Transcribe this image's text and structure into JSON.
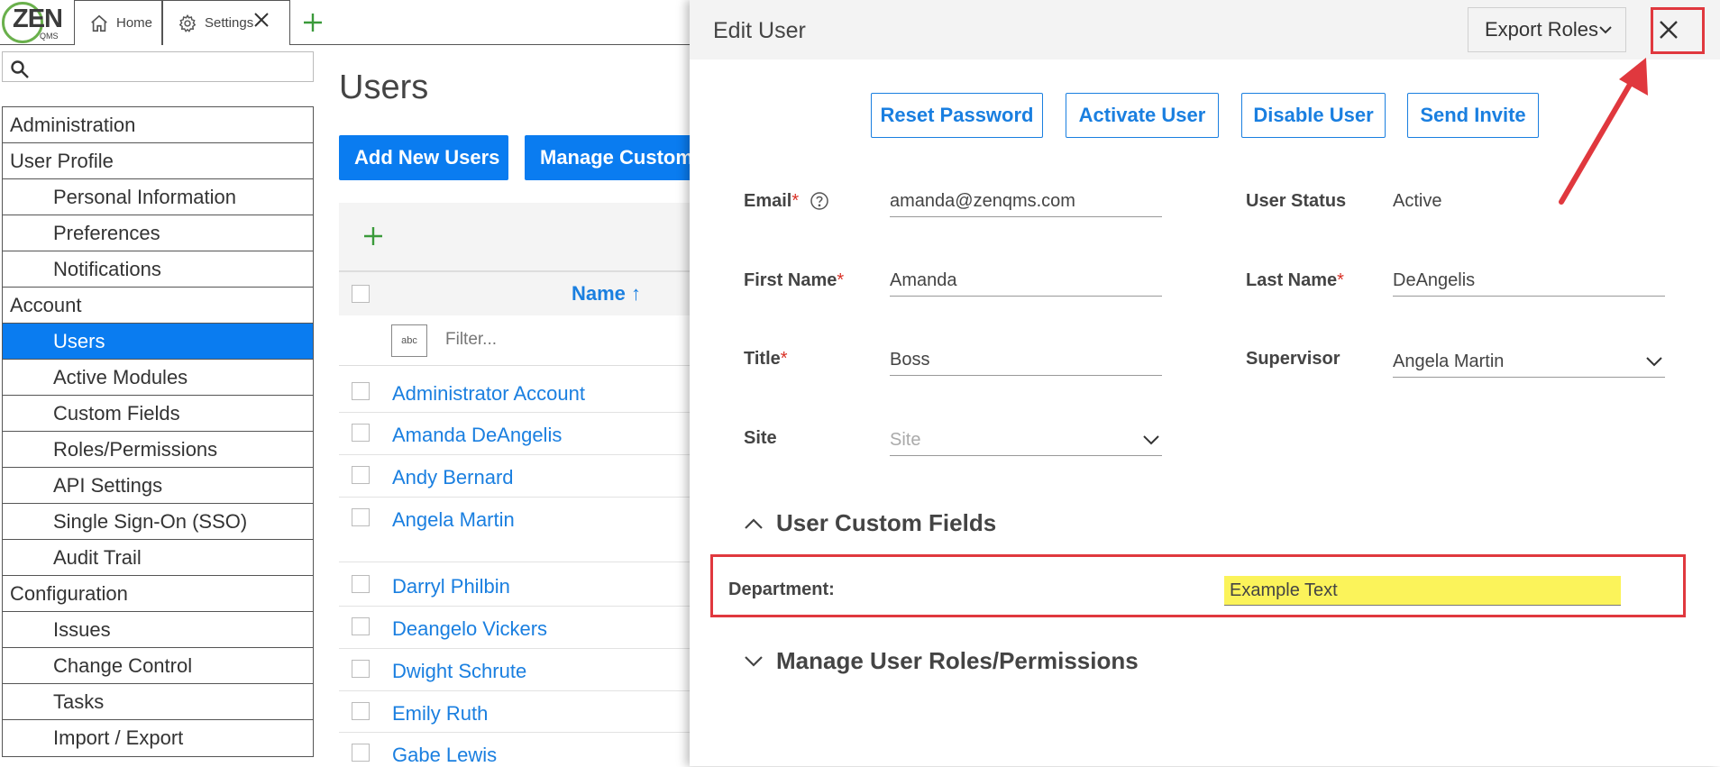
{
  "logo": {
    "text": "ZEN",
    "sub": "QMS"
  },
  "tabs": [
    {
      "label": "Home",
      "icon": "home-icon"
    },
    {
      "label": "Settings",
      "icon": "gear-icon"
    }
  ],
  "search": {
    "placeholder": ""
  },
  "sidebar": {
    "items": [
      {
        "label": "Administration",
        "level": 0
      },
      {
        "label": "User Profile",
        "level": 0
      },
      {
        "label": "Personal Information",
        "level": 1
      },
      {
        "label": "Preferences",
        "level": 1
      },
      {
        "label": "Notifications",
        "level": 1
      },
      {
        "label": "Account",
        "level": 0
      },
      {
        "label": "Users",
        "level": 1,
        "active": true
      },
      {
        "label": "Active Modules",
        "level": 1
      },
      {
        "label": "Custom Fields",
        "level": 1
      },
      {
        "label": "Roles/Permissions",
        "level": 1
      },
      {
        "label": "API Settings",
        "level": 1
      },
      {
        "label": "Single Sign-On (SSO)",
        "level": 1
      },
      {
        "label": "Audit Trail",
        "level": 1
      },
      {
        "label": "Configuration",
        "level": 0
      },
      {
        "label": "Issues",
        "level": 1
      },
      {
        "label": "Change Control",
        "level": 1
      },
      {
        "label": "Tasks",
        "level": 1
      },
      {
        "label": "Import / Export",
        "level": 1
      }
    ]
  },
  "users_page": {
    "title": "Users",
    "add_button": "Add New Users",
    "manage_button": "Manage Custom",
    "column_name": "Name ↑",
    "filter_icon": "abc",
    "filter_placeholder": "Filter...",
    "rows": [
      "Administrator Account",
      "Amanda DeAngelis",
      "Andy Bernard",
      "Angela Martin",
      "Darryl Philbin",
      "Deangelo Vickers",
      "Dwight Schrute",
      "Emily Ruth",
      "Gabe Lewis"
    ]
  },
  "drawer": {
    "title": "Edit User",
    "export_label": "Export Roles",
    "actions": {
      "reset": "Reset Password",
      "activate": "Activate User",
      "disable": "Disable User",
      "invite": "Send Invite"
    },
    "fields": {
      "email_label": "Email",
      "email_value": "amanda@zenqms.com",
      "status_label": "User Status",
      "status_value": "Active",
      "first_label": "First Name",
      "first_value": "Amanda",
      "last_label": "Last Name",
      "last_value": "DeAngelis",
      "title_label": "Title",
      "title_value": "Boss",
      "supervisor_label": "Supervisor",
      "supervisor_value": "Angela Martin",
      "site_label": "Site",
      "site_placeholder": "Site",
      "required_mark": "*"
    },
    "custom_fields_heading": "User Custom Fields",
    "department_label": "Department:",
    "department_value": "Example Text",
    "roles_heading": "Manage User Roles/Permissions"
  },
  "colors": {
    "primary": "#0a7cf0",
    "link": "#1a7fe0",
    "highlight": "#fbf35a",
    "annotation": "#e0383e",
    "logo_green": "#6ab04c"
  }
}
